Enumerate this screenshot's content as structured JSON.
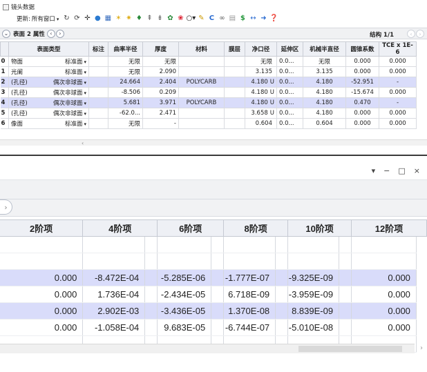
{
  "top": {
    "title": "镜头数据",
    "toolbar": {
      "update_label": "更新:",
      "update_value": "所有窗口"
    },
    "tabs": {
      "surface_label": "表面",
      "properties_label": "2 属性"
    },
    "structure_label": "结构 1/1",
    "columns": [
      "表面类型",
      "标注",
      "曲率半径",
      "厚度",
      "材料",
      "膜层",
      "净口径",
      "延伸区",
      "机械半直径",
      "圆锥系数",
      "TCE x 1E-6"
    ],
    "rows": [
      {
        "idx": "0",
        "name": "物面",
        "type": "标准面",
        "radius": "无限",
        "thick": "无限",
        "mat": "",
        "clear": "无限",
        "clear_flag": "",
        "ext": "0.0...",
        "mech": "无限",
        "conic": "0.000",
        "tce": "0.000",
        "hl": false
      },
      {
        "idx": "1",
        "name": "光阑",
        "type": "标准面",
        "radius": "无限",
        "thick": "2.090",
        "mat": "",
        "clear": "3.135",
        "clear_flag": "",
        "ext": "0.0...",
        "mech": "3.135",
        "conic": "0.000",
        "tce": "0.000",
        "hl": false
      },
      {
        "idx": "2",
        "name": "(孔径)",
        "type": "偶次非球面",
        "radius": "24.664",
        "thick": "2.404",
        "mat": "POLYCARB",
        "clear": "4.180",
        "clear_flag": "U",
        "ext": "0.0...",
        "mech": "4.180",
        "conic": "-52.951",
        "tce": "-",
        "hl": true
      },
      {
        "idx": "3",
        "name": "(孔径)",
        "type": "偶次非球面",
        "radius": "-8.506",
        "thick": "0.209",
        "mat": "",
        "clear": "4.180",
        "clear_flag": "U",
        "ext": "0.0...",
        "mech": "4.180",
        "conic": "-15.674",
        "tce": "0.000",
        "hl": false
      },
      {
        "idx": "4",
        "name": "(孔径)",
        "type": "偶次非球面",
        "radius": "5.681",
        "thick": "3.971",
        "mat": "POLYCARB",
        "clear": "4.180",
        "clear_flag": "U",
        "ext": "0.0...",
        "mech": "4.180",
        "conic": "0.470",
        "tce": "-",
        "hl": true
      },
      {
        "idx": "5",
        "name": "(孔径)",
        "type": "偶次非球面",
        "radius": "-62.0...",
        "thick": "2.471",
        "mat": "",
        "clear": "3.658",
        "clear_flag": "U",
        "ext": "0.0...",
        "mech": "4.180",
        "conic": "0.000",
        "tce": "0.000",
        "hl": false
      },
      {
        "idx": "6",
        "name": "像面",
        "type": "标准面",
        "radius": "无限",
        "thick": "-",
        "mat": "",
        "clear": "0.604",
        "clear_flag": "",
        "ext": "0.0...",
        "mech": "0.604",
        "conic": "0.000",
        "tce": "0.000",
        "hl": false
      }
    ]
  },
  "bottom": {
    "window_controls": {
      "menu": "▾",
      "minimize": "−",
      "restore": "□",
      "close": "×"
    },
    "columns": [
      "2阶项",
      "4阶项",
      "6阶项",
      "8阶项",
      "10阶项",
      "12阶项"
    ],
    "rows": [
      {
        "c": [
          "",
          "",
          "",
          "",
          "",
          ""
        ],
        "hl": false
      },
      {
        "c": [
          "",
          "",
          "",
          "",
          "",
          ""
        ],
        "hl": false
      },
      {
        "c": [
          "0.000",
          "-8.472E-04",
          "-5.285E-06",
          "-1.777E-07",
          "-9.325E-09",
          "0.000"
        ],
        "hl": true
      },
      {
        "c": [
          "0.000",
          "1.736E-04",
          "-2.434E-05",
          "6.718E-09",
          "-3.959E-09",
          "0.000"
        ],
        "hl": false
      },
      {
        "c": [
          "0.000",
          "2.902E-03",
          "-3.436E-05",
          "1.370E-08",
          "8.839E-09",
          "0.000"
        ],
        "hl": true
      },
      {
        "c": [
          "0.000",
          "-1.058E-04",
          "9.683E-05",
          "-6.744E-07",
          "-5.010E-08",
          "0.000"
        ],
        "hl": false
      },
      {
        "c": [
          "",
          "",
          "",
          "",
          "",
          ""
        ],
        "hl": false
      }
    ]
  },
  "colors": {
    "highlight_row": "#d9dcfa",
    "header_bg": "#eef0f5"
  }
}
